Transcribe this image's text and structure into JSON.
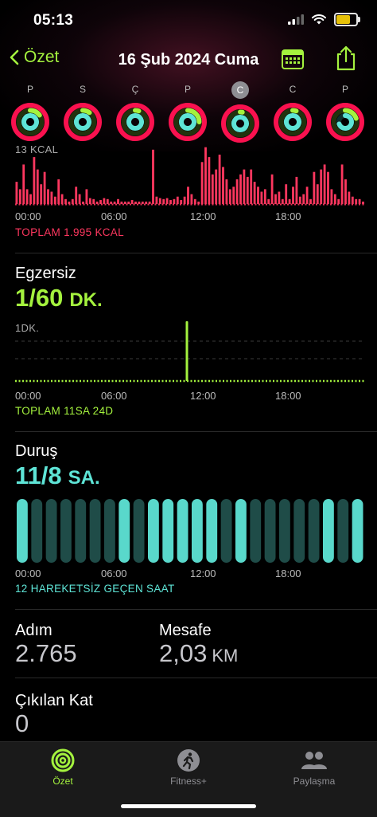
{
  "status_bar": {
    "time": "05:13"
  },
  "nav": {
    "back_label": "Özet",
    "title": "16 Şub 2024 Cuma"
  },
  "week": {
    "days": [
      {
        "letter": "P",
        "move": 1.0,
        "exercise": 0.15,
        "stand": 1.0
      },
      {
        "letter": "S",
        "move": 1.0,
        "exercise": 0.1,
        "stand": 1.0
      },
      {
        "letter": "Ç",
        "move": 1.0,
        "exercise": 0.05,
        "stand": 1.0
      },
      {
        "letter": "P",
        "move": 1.0,
        "exercise": 0.25,
        "stand": 1.0
      },
      {
        "letter": "C",
        "move": 1.0,
        "exercise": 0.03,
        "stand": 1.0,
        "selected": true
      },
      {
        "letter": "C",
        "move": 1.0,
        "exercise": 0.05,
        "stand": 1.0
      },
      {
        "letter": "P",
        "move": 1.0,
        "exercise": 0.2,
        "stand": 0.7
      }
    ]
  },
  "move": {
    "max_label": "13 KCAL",
    "total_label": "TOPLAM 1.995 KCAL",
    "color": "#ff375f",
    "bars": [
      0.45,
      0.3,
      0.8,
      0.3,
      0.2,
      0.95,
      0.7,
      0.4,
      0.65,
      0.3,
      0.25,
      0.15,
      0.5,
      0.2,
      0.1,
      0.05,
      0.1,
      0.35,
      0.2,
      0.05,
      0.3,
      0.12,
      0.1,
      0.05,
      0.08,
      0.12,
      0.1,
      0.05,
      0.05,
      0.1,
      0.05,
      0.05,
      0.05,
      0.08,
      0.05,
      0.05,
      0.05,
      0.05,
      0.05,
      1.1,
      0.15,
      0.12,
      0.1,
      0.12,
      0.08,
      0.1,
      0.15,
      0.08,
      0.15,
      0.35,
      0.2,
      0.1,
      0.05,
      0.85,
      1.15,
      0.95,
      0.6,
      0.7,
      1.0,
      0.75,
      0.5,
      0.3,
      0.35,
      0.5,
      0.6,
      0.7,
      0.55,
      0.7,
      0.45,
      0.35,
      0.25,
      0.3,
      0.1,
      0.6,
      0.2,
      0.25,
      0.1,
      0.4,
      0.1,
      0.35,
      0.55,
      0.15,
      0.2,
      0.35,
      0.1,
      0.65,
      0.4,
      0.7,
      0.8,
      0.65,
      0.3,
      0.2,
      0.1,
      0.8,
      0.5,
      0.25,
      0.15,
      0.1,
      0.1,
      0.05
    ]
  },
  "exercise": {
    "title": "Egzersiz",
    "value": "1/60",
    "unit": "DK.",
    "max_label": "1DK.",
    "total_label": "TOPLAM 11SA 24D",
    "color": "#a4f23e",
    "spike_hour": 11.7
  },
  "stand": {
    "title": "Duruş",
    "value": "11/8",
    "unit": "SA.",
    "summary_label": "12 HAREKETSİZ GEÇEN SAAT",
    "color": "#5ee4d6",
    "hours": [
      1,
      0,
      0,
      0,
      0,
      0,
      0,
      1,
      0,
      1,
      1,
      1,
      1,
      1,
      0,
      1,
      0,
      0,
      0,
      0,
      0,
      1,
      0,
      1
    ]
  },
  "axis_labels": [
    "00:00",
    "06:00",
    "12:00",
    "18:00"
  ],
  "steps": {
    "label": "Adım",
    "value": "2.765"
  },
  "distance": {
    "label": "Mesafe",
    "value": "2,03",
    "unit": "KM"
  },
  "floors": {
    "label": "Çıkılan Kat",
    "value": "0"
  },
  "tabs": [
    {
      "label": "Özet",
      "icon": "activity-rings-icon",
      "active": true
    },
    {
      "label": "Fitness+",
      "icon": "running-figure-icon",
      "active": false
    },
    {
      "label": "Paylaşma",
      "icon": "people-icon",
      "active": false
    }
  ]
}
